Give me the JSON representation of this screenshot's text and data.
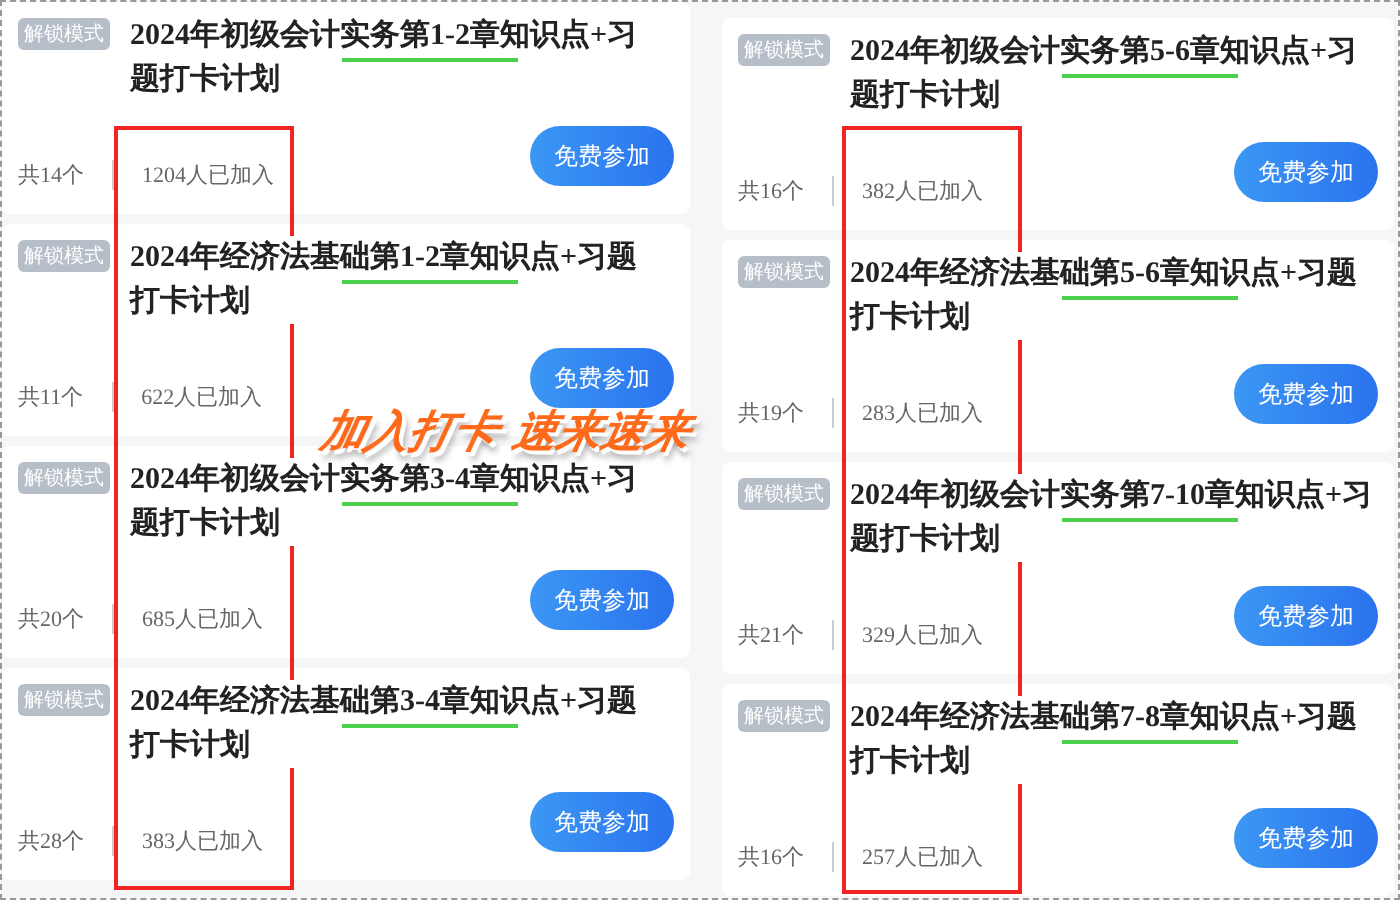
{
  "columns": [
    {
      "cards": [
        {
          "badge": "解锁模式",
          "title": "2024年初级会计实务第1-2章知识点+习题打卡计划",
          "count": "共14个",
          "joined": "1204人已加入",
          "button": "免费参加"
        },
        {
          "badge": "解锁模式",
          "title": "2024年经济法基础第1-2章知识点+习题打卡计划",
          "count": "共11个",
          "joined": "622人已加入",
          "button": "免费参加"
        },
        {
          "badge": "解锁模式",
          "title": "2024年初级会计实务第3-4章知识点+习题打卡计划",
          "count": "共20个",
          "joined": "685人已加入",
          "button": "免费参加"
        },
        {
          "badge": "解锁模式",
          "title": "2024年经济法基础第3-4章知识点+习题打卡计划",
          "count": "共28个",
          "joined": "383人已加入",
          "button": "免费参加"
        }
      ]
    },
    {
      "cards": [
        {
          "badge": "解锁模式",
          "title": "2024年初级会计实务第5-6章知识点+习题打卡计划",
          "count": "共16个",
          "joined": "382人已加入",
          "button": "免费参加"
        },
        {
          "badge": "解锁模式",
          "title": "2024年经济法基础第5-6章知识点+习题打卡计划",
          "count": "共19个",
          "joined": "283人已加入",
          "button": "免费参加"
        },
        {
          "badge": "解锁模式",
          "title": "2024年初级会计实务第7-10章知识点+习题打卡计划",
          "count": "共21个",
          "joined": "329人已加入",
          "button": "免费参加"
        },
        {
          "badge": "解锁模式",
          "title": "2024年经济法基础第7-8章知识点+习题打卡计划",
          "count": "共16个",
          "joined": "257人已加入",
          "button": "免费参加"
        }
      ]
    }
  ],
  "overlay_text": "加入打卡 速来速来"
}
